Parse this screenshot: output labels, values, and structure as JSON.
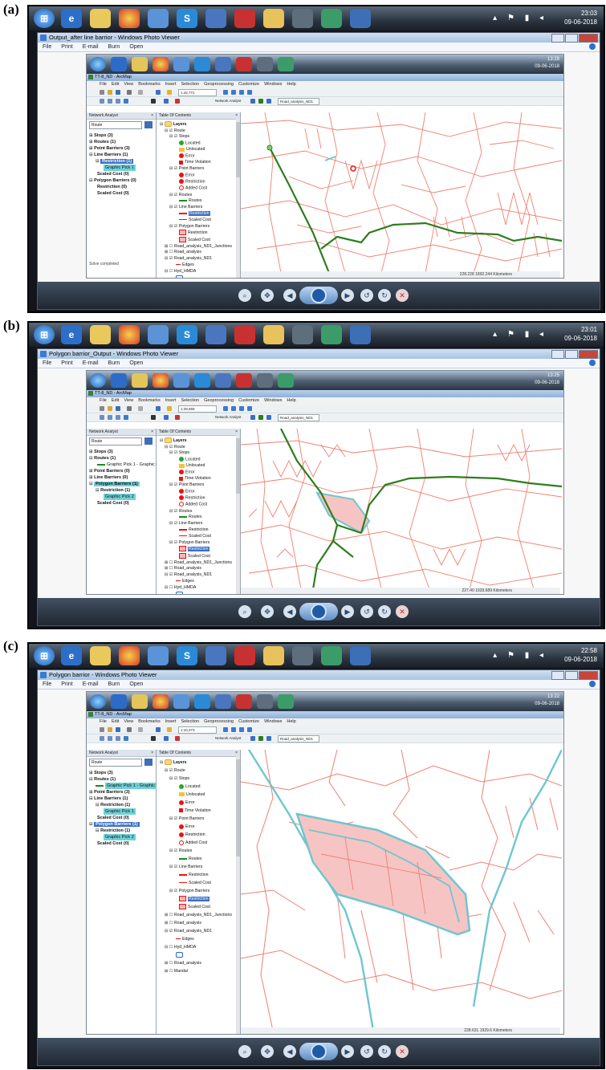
{
  "panels": [
    {
      "label": "(a)",
      "window_title": "Output_after line barrior - Windows Photo Viewer",
      "menu": [
        "File",
        "Print",
        "E-mail",
        "Burn",
        "Open"
      ],
      "clock_time": "23:03",
      "clock_date": "09-06-2018",
      "inner_clock_time": "13:28",
      "inner_clock_date": "09-06-2018",
      "arcmap_title": "TT-8_ND - ArcMap",
      "arcmap_menu": [
        "File",
        "Edit",
        "View",
        "Bookmarks",
        "Insert",
        "Selection",
        "Geoprocessing",
        "Customize",
        "Windows",
        "Help"
      ],
      "scale": "1:42,771",
      "network_analyst_label": "Network Analyst",
      "layer_dropdown": "Road_analysis_ND1",
      "na_panel_title": "Network Analyst",
      "na_combo": "Route",
      "na_tree": [
        "Stops (3)",
        "Routes (1)",
        "Point Barriers (3)",
        "Line Barriers (1)",
        "Restriction (1)",
        "Graphic Pick 1",
        "Scaled Cost (0)",
        "Polygon Barriers (0)",
        "Restriction (0)",
        "Scaled Cost (0)"
      ],
      "status_text": "Solve completed",
      "map_status": "228.228  1892.244 Kilometers"
    },
    {
      "label": "(b)",
      "window_title": "Polygon barrior_Output - Windows Photo Viewer",
      "menu": [
        "File",
        "Print",
        "E-mail",
        "Burn",
        "Open"
      ],
      "clock_time": "23:01",
      "clock_date": "09-06-2018",
      "inner_clock_time": "13:25",
      "inner_clock_date": "09-06-2018",
      "arcmap_title": "TT-8_ND - ArcMap",
      "arcmap_menu": [
        "File",
        "Edit",
        "View",
        "Bookmarks",
        "Insert",
        "Selection",
        "Geoprocessing",
        "Customize",
        "Windows",
        "Help"
      ],
      "scale": "1:28,559",
      "network_analyst_label": "Network Analyst",
      "layer_dropdown": "Road_analysis_ND1",
      "na_panel_title": "Network Analyst",
      "na_combo": "Route",
      "na_tree": [
        "Stops (3)",
        "Routes (1)",
        "Graphic Pick 1 - Graphic Pick",
        "Point Barriers (0)",
        "Line Barriers (0)",
        "Polygon Barriers (1)",
        "Restriction (1)",
        "Graphic Pick 2",
        "Scaled Cost (0)"
      ],
      "status_text": "",
      "map_status": "227.40  1929.689 Kilometers"
    },
    {
      "label": "(c)",
      "window_title": "Polygon barrior - Windows Photo Viewer",
      "menu": [
        "File",
        "Print",
        "E-mail",
        "Burn",
        "Open"
      ],
      "clock_time": "22:58",
      "clock_date": "09-06-2018",
      "inner_clock_time": "13:22",
      "inner_clock_date": "09-06-2018",
      "arcmap_title": "TT-8_ND - ArcMap",
      "arcmap_menu": [
        "File",
        "Edit",
        "View",
        "Bookmarks",
        "Insert",
        "Selection",
        "Geoprocessing",
        "Customize",
        "Windows",
        "Help"
      ],
      "scale": "1:10,373",
      "network_analyst_label": "Network Analyst",
      "layer_dropdown": "Road_analysis_ND1",
      "na_panel_title": "Network Analyst",
      "na_combo": "Route",
      "na_tree": [
        "Stops (3)",
        "Routes (1)",
        "Graphic Pick 1 - Graphic Pick",
        "Point Barriers (3)",
        "Line Barriers (1)",
        "Restriction (1)",
        "Graphic Pick 1",
        "Scaled Cost (0)",
        "Polygon Barriers (1)",
        "Restriction (1)",
        "Graphic Pick 2",
        "Scaled Cost (0)"
      ],
      "status_text": "",
      "map_status": "228.631  1929.6 Kilometers"
    }
  ],
  "toc": {
    "title": "Table Of Contents",
    "items": [
      "Layers",
      "Route",
      "Stops",
      "Located",
      "Unlocated",
      "Error",
      "Time Violation",
      "Point Barriers",
      "Error",
      "Restriction",
      "Added Cost",
      "Routes",
      "Routes",
      "Line Barriers",
      "Restriction",
      "Scaled Cost",
      "Polygon Barriers",
      "Restriction",
      "Scaled Cost",
      "Road_analysis_ND1_Junctions",
      "Road_analysis",
      "Road_analysis_ND1",
      "Edges",
      "Hyd_HMDA",
      "Road_analysis",
      "Mandal"
    ]
  },
  "colors": {
    "road": "#f08070",
    "route": "#2e7d1e",
    "barrier_outline": "#6fc6cf",
    "barrier_fill": "#f7c4c4"
  }
}
